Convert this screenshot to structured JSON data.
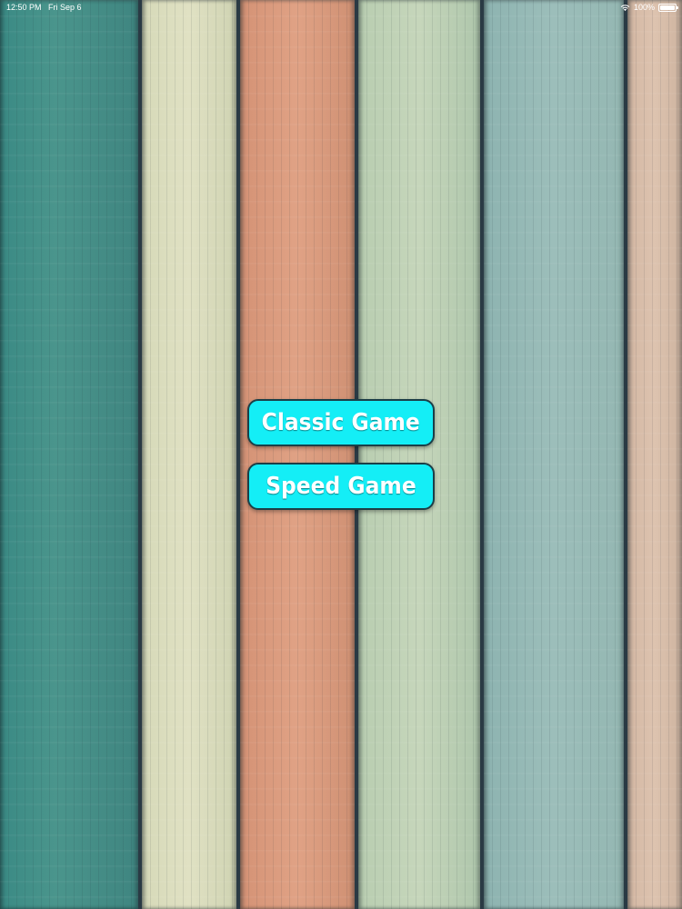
{
  "status_bar": {
    "time": "12:50 PM",
    "date": "Fri Sep 6",
    "battery": "100%",
    "wifi_icon": "wifi-icon",
    "battery_icon": "battery-icon"
  },
  "menu": {
    "classic_label": "Classic Game",
    "speed_label": "Speed Game"
  },
  "colors": {
    "button_fill": "#14eef6",
    "button_border": "#1b3f47",
    "plank_teal": "#3f8c86",
    "plank_cream": "#d9dcbc",
    "plank_salmon": "#d99879",
    "plank_sage": "#a8c4ad",
    "plank_blue_grey": "#8fb4b2",
    "plank_peach": "#d6b7a2"
  }
}
